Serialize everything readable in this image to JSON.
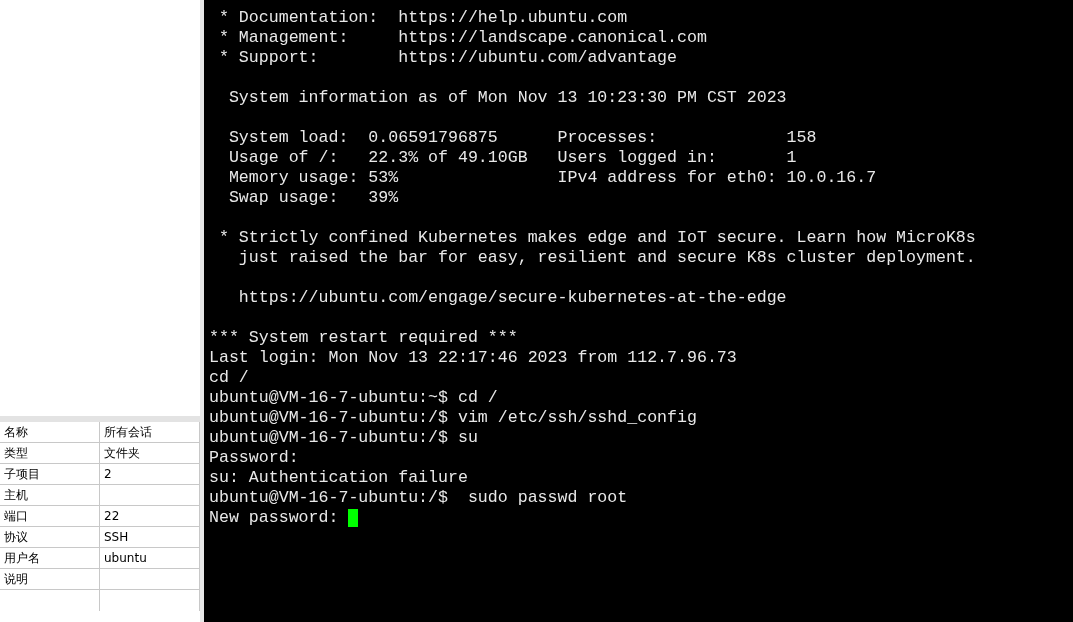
{
  "session_properties": {
    "rows": [
      {
        "name": "名称",
        "value": "所有会话"
      },
      {
        "name": "类型",
        "value": "文件夹"
      },
      {
        "name": "子项目",
        "value": "2"
      },
      {
        "name": "主机",
        "value": ""
      },
      {
        "name": "端口",
        "value": "22"
      },
      {
        "name": "协议",
        "value": "SSH"
      },
      {
        "name": "用户名",
        "value": "ubuntu"
      },
      {
        "name": "说明",
        "value": ""
      }
    ]
  },
  "terminal": {
    "cursor": true,
    "blocks": [
      {
        "lines": [
          " * Documentation:  https://help.ubuntu.com",
          " * Management:     https://landscape.canonical.com",
          " * Support:        https://ubuntu.com/advantage"
        ]
      },
      {
        "lines": [
          "  System information as of Mon Nov 13 10:23:30 PM CST 2023"
        ]
      },
      {
        "lines": [
          "  System load:  0.06591796875      Processes:             158",
          "  Usage of /:   22.3% of 49.10GB   Users logged in:       1",
          "  Memory usage: 53%                IPv4 address for eth0: 10.0.16.7",
          "  Swap usage:   39%"
        ]
      },
      {
        "lines": [
          " * Strictly confined Kubernetes makes edge and IoT secure. Learn how MicroK8s",
          "   just raised the bar for easy, resilient and secure K8s cluster deployment."
        ]
      },
      {
        "lines": [
          "   https://ubuntu.com/engage/secure-kubernetes-at-the-edge"
        ]
      },
      {
        "lines": [
          "*** System restart required ***",
          "Last login: Mon Nov 13 22:17:46 2023 from 112.7.96.73",
          "cd /",
          "ubuntu@VM-16-7-ubuntu:~$ cd /",
          "ubuntu@VM-16-7-ubuntu:/$ vim /etc/ssh/sshd_config",
          "ubuntu@VM-16-7-ubuntu:/$ su",
          "Password:",
          "su: Authentication failure",
          "ubuntu@VM-16-7-ubuntu:/$  sudo passwd root",
          "New password: "
        ]
      }
    ]
  }
}
